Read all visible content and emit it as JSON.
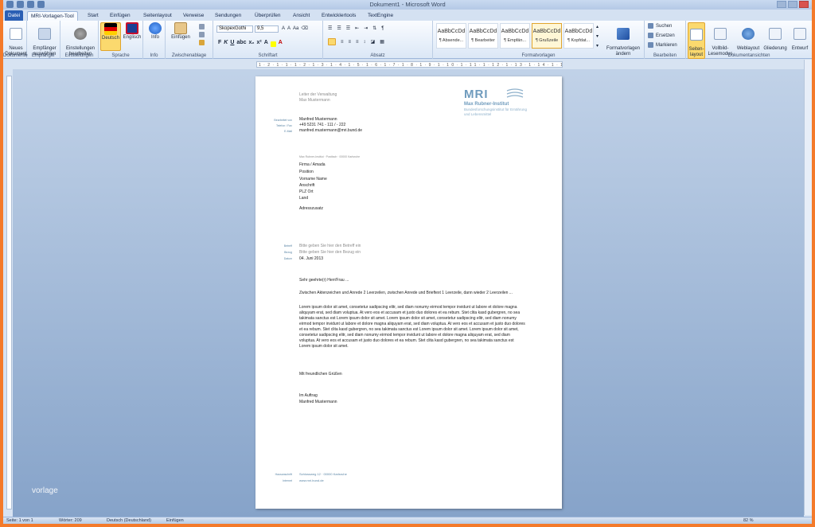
{
  "window": {
    "title": "Dokument1 - Microsoft Word"
  },
  "tabs": [
    "Datei",
    "MRI-Vorlagen-Tool",
    "Start",
    "Einfügen",
    "Seitenlayout",
    "Verweise",
    "Sendungen",
    "Überprüfen",
    "Ansicht",
    "Entwicklertools",
    "TextEngine"
  ],
  "ribbon": {
    "dokumente": {
      "new_label": "Neues\nDokument",
      "group": "Dokumente"
    },
    "empfaenger": {
      "btn": "Empfänger\nauswählen",
      "group": "Empfänger"
    },
    "einstellungen": {
      "btn": "Einstellungen\nbearbeiten",
      "group": "Einstellungen"
    },
    "sprache": {
      "deutsch": "Deutsch",
      "englisch": "Englisch",
      "group": "Sprache"
    },
    "info": {
      "btn": "Info",
      "group": "Info"
    },
    "zwischenablage": {
      "btn": "Einfügen",
      "group": "Zwischenablage"
    },
    "schriftart": {
      "font": "SkopexGothi",
      "size": "9,5",
      "group": "Schriftart"
    },
    "absatz": {
      "group": "Absatz"
    },
    "formatvorlagen": {
      "group": "Formatvorlagen",
      "tiles": [
        {
          "preview": "AaBbCcDd",
          "name": "¶ Absende..."
        },
        {
          "preview": "AaBbCcDd",
          "name": "¶ Bearbeiter"
        },
        {
          "preview": "AaBbCcDd",
          "name": "¶ Empfän..."
        },
        {
          "preview": "AaBbCcDd",
          "name": "¶ Grußzeile"
        },
        {
          "preview": "AaBbCcDd",
          "name": "¶ Kopfdat..."
        }
      ],
      "change": "Formatvorlagen\nändern"
    },
    "bearbeiten": {
      "suchen": "Suchen",
      "ersetzen": "Ersetzen",
      "markieren": "Markieren",
      "group": "Bearbeiten"
    },
    "ansichten": {
      "group": "Dokumentansichten",
      "items": [
        "Seiten-\nlayout",
        "Vollbild-\nLesemodus",
        "Weblayout",
        "Gliederung",
        "Entwurf"
      ]
    }
  },
  "document": {
    "sender_title": "Leiter der Verwaltung",
    "sender_name": "Max Mustermann",
    "labels": {
      "bearbeiter": "Bearbeitet von",
      "telefon": "Telefon / Fax",
      "email": "E-Mail"
    },
    "contact_name": "Manfred Mustermann",
    "contact_phone": "+49 5231 741 - 111 / - 222",
    "contact_email": "manfred.mustermann@mri.bund.de",
    "logo_mri": "MRI",
    "logo_name": "Max Rubner-Institut",
    "logo_sub": "Bundesforschungsinstitut für Ernährung und Lebensmittel",
    "return_line": "Max Rubner-Institut · Postfach · 00000 Karlsruhe",
    "recipient": [
      "Firma / Amada",
      "Position",
      "Vorname Name",
      "Anschrift",
      "PLZ Ort",
      "Land"
    ],
    "address_extra": "Adresszusatz",
    "labels2": {
      "betreff": "Betreff",
      "bezug": "Bezug",
      "datum": "Datum"
    },
    "betreff": "Bitte geben Sie hier den Betreff ein",
    "bezug": "Bitte geben Sie hier den Bezug ein",
    "datum": "04. Juni 2013",
    "salutation": "Sehr geehrte(r) Herr/Frau ...",
    "note": "Zwischen Aktenzeichen und Anrede 2 Leerzeilen, zwischen Anrede und Brieftext 1 Leerzeile, dann wieder 2 Leerzeilen ...",
    "lorem": "Lorem ipsum dolor sit amet, consetetur sadipscing elitr, sed diam nonumy eirmod tempor invidunt ut labore et dolore magna aliquyam erat, sed diam voluptua. At vero eos et accusam et justo duo dolores et ea rebum. Stet clita kasd gubergren, no sea takimata sanctus est Lorem ipsum dolor sit amet. Lorem ipsum dolor sit amet, consetetur sadipscing elitr, sed diam nonumy eirmod tempor invidunt ut labore et dolore magna aliquyam erat, sed diam voluptua. At vero eos et accusam et justo duo dolores et ea rebum. Stet clita kasd gubergren, no sea takimata sanctus est Lorem ipsum dolor sit amet. Lorem ipsum dolor sit amet, consetetur sadipscing elitr, sed diam nonumy eirmod tempor invidunt ut labore et dolore magna aliquyam erat, sed diam voluptua. At vero eos et accusam et justo duo dolores et ea rebum. Stet clita kasd gubergren, no sea takimata sanctus est Lorem ipsum dolor sit amet.",
    "closing": "Mit freundlichen Grüßen",
    "sign_role": "Im Auftrag",
    "sign_name": "Manfred Mustermann",
    "footer_labels": {
      "hausanschrift": "Hausanschrift",
      "internet": "Internet"
    },
    "footer_addr": "Schlossweg 12 · 00000 Karlsruhe",
    "footer_web": "www.mri.bund.de"
  },
  "watermark": "vorlage",
  "status": {
    "page": "Seite: 1 von 1",
    "words": "Wörter: 209",
    "lang": "Deutsch (Deutschland)",
    "mode": "Einfügen",
    "zoom": "82 %"
  }
}
